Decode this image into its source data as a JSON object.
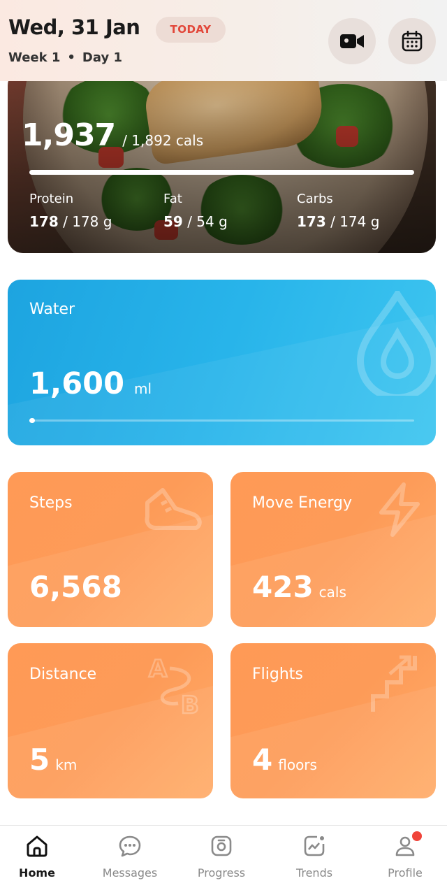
{
  "header": {
    "date": "Wed, 31 Jan",
    "today_badge": "TODAY",
    "week": "Week 1",
    "separator": "•",
    "day": "Day 1",
    "icons": [
      "video-camera-icon",
      "calendar-icon"
    ]
  },
  "nutrition": {
    "calories_eaten": "1,937",
    "calories_target": "/ 1,892 cals",
    "calories_progress": 1.0,
    "macros": [
      {
        "label": "Protein",
        "value": "178",
        "target": "/ 178 g"
      },
      {
        "label": "Fat",
        "value": "59",
        "target": "/ 54 g"
      },
      {
        "label": "Carbs",
        "value": "173",
        "target": "/ 174 g"
      }
    ]
  },
  "water": {
    "title": "Water",
    "value": "1,600",
    "unit": "ml",
    "progress": 0.0,
    "icon": "water-drop-icon"
  },
  "tiles": {
    "steps": {
      "title": "Steps",
      "value": "6,568",
      "unit": "",
      "icon": "shoe-icon"
    },
    "move": {
      "title": "Move Energy",
      "value": "423",
      "unit": "cals",
      "icon": "lightning-icon"
    },
    "distance": {
      "title": "Distance",
      "value": "5",
      "unit": "km",
      "icon": "a-to-b-icon"
    },
    "flights": {
      "title": "Flights",
      "value": "4",
      "unit": "floors",
      "icon": "stairs-icon"
    }
  },
  "nav": {
    "items": [
      {
        "label": "Home",
        "icon": "home-icon",
        "active": true
      },
      {
        "label": "Messages",
        "icon": "chat-bubble-icon",
        "active": false
      },
      {
        "label": "Progress",
        "icon": "scale-icon",
        "active": false
      },
      {
        "label": "Trends",
        "icon": "trend-chart-icon",
        "active": false
      },
      {
        "label": "Profile",
        "icon": "profile-icon",
        "active": false
      }
    ]
  },
  "colors": {
    "accent_red": "#e2473a",
    "water_blue": "#28b4ea",
    "tile_orange": "#fd9b58",
    "notification_dot": "#f0443a"
  }
}
